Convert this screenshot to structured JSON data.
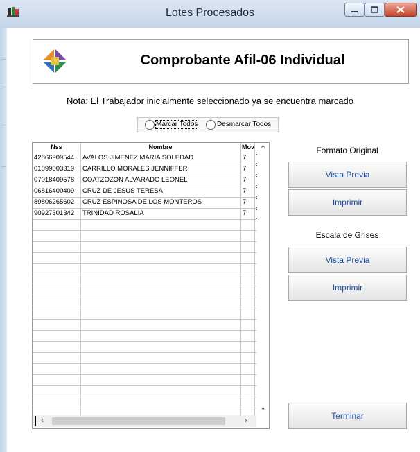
{
  "window": {
    "title": "Lotes Procesados"
  },
  "header": {
    "title": "Comprobante Afil-06 Individual"
  },
  "note": "Nota: El Trabajador inicialmente seleccionado ya se encuentra marcado",
  "selection": {
    "mark_all": "Marcar Todos",
    "unmark_all": "Desmarcar Todos"
  },
  "grid": {
    "columns": [
      "Nss",
      "Nombre",
      "Mov"
    ],
    "rows": [
      {
        "nss": "42866909544",
        "nombre": "AVALOS JIMENEZ MARIA SOLEDAD",
        "mov": "7",
        "checked": false
      },
      {
        "nss": "01099003319",
        "nombre": "CARRILLO MORALES JENNIFFER",
        "mov": "7",
        "checked": false
      },
      {
        "nss": "07018409578",
        "nombre": "COATZOZON ALVARADO LEONEL",
        "mov": "7",
        "checked": false
      },
      {
        "nss": "06816400409",
        "nombre": "CRUZ DE JESUS TERESA",
        "mov": "7",
        "checked": true
      },
      {
        "nss": "89806265602",
        "nombre": "CRUZ ESPINOSA DE LOS MONTEROS",
        "mov": "7",
        "checked": false
      },
      {
        "nss": "90927301342",
        "nombre": "TRINIDAD  ROSALIA",
        "mov": "7",
        "checked": false
      }
    ]
  },
  "formato_original": {
    "label": "Formato Original",
    "preview": "Vista Previa",
    "print": "Imprimir"
  },
  "escala_grises": {
    "label": "Escala de Grises",
    "preview": "Vista Previa",
    "print": "Imprimir"
  },
  "finish": "Terminar",
  "icons": {
    "app": "app-icon",
    "logo": "product-logo-icon",
    "minimize": "minimize-icon",
    "maximize": "maximize-icon",
    "close": "close-icon"
  }
}
